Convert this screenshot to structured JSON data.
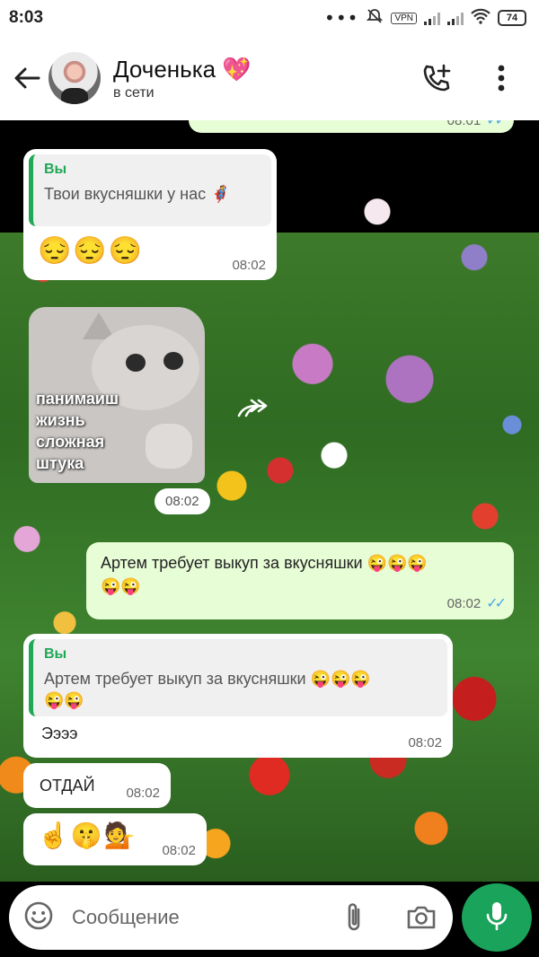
{
  "status_bar": {
    "time": "8:03",
    "vpn_label": "VPN",
    "battery": "74",
    "icons": [
      "more-dots-icon",
      "alarm-off-icon",
      "vpn-icon",
      "signal-icon",
      "signal-icon",
      "wifi-icon",
      "battery-icon"
    ]
  },
  "header": {
    "contact_name": "Доченька",
    "name_emoji": "💖",
    "status": "в сети",
    "icons": [
      "back-arrow-icon",
      "add-call-icon",
      "more-vert-icon"
    ]
  },
  "messages": [
    {
      "type": "outgoing-partial",
      "time": "08:01",
      "read": true
    },
    {
      "type": "incoming",
      "quote": {
        "author": "Вы",
        "text": "Твои вкусняшки у нас 🦸"
      },
      "text": "😔😔😔",
      "time": "08:02"
    },
    {
      "type": "sticker",
      "caption": "панимаиш\nжизнь\nсложная\nштука",
      "time": "08:02",
      "forward_icon": "forward-icon"
    },
    {
      "type": "outgoing",
      "text": "Артем требует выкуп за вкусняшки 😜😜😜\n😜😜",
      "time": "08:02",
      "read": true
    },
    {
      "type": "incoming",
      "quote": {
        "author": "Вы",
        "text": "Артем требует выкуп за вкусняшки 😜😜😜\n😜😜"
      },
      "text": "Ээээ",
      "time": "08:02"
    },
    {
      "type": "incoming",
      "text": "ОТДАЙ",
      "time": "08:02"
    },
    {
      "type": "incoming",
      "text": "☝️🤫💁",
      "time": "08:02"
    }
  ],
  "input": {
    "placeholder": "Сообщение",
    "icons": [
      "emoji-icon",
      "attach-icon",
      "camera-icon",
      "mic-icon"
    ]
  },
  "colors": {
    "accent_green": "#1aa35a",
    "outgoing_bubble": "#e7fdd6",
    "incoming_bubble": "#ffffff",
    "read_checks": "#4aa9e8",
    "quote_bar": "#1fa855"
  }
}
